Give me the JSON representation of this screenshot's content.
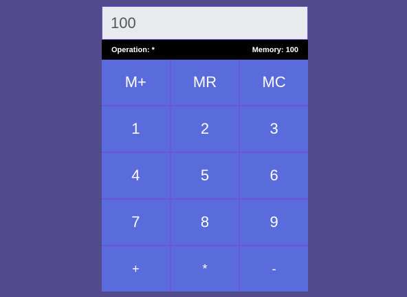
{
  "display": {
    "value": "100"
  },
  "status": {
    "operation": "Operation: *",
    "memory": "Memory: 100"
  },
  "buttons": [
    {
      "label": "M+",
      "name": "memory-add-button"
    },
    {
      "label": "MR",
      "name": "memory-recall-button"
    },
    {
      "label": "MC",
      "name": "memory-clear-button"
    },
    {
      "label": "1",
      "name": "digit-1-button"
    },
    {
      "label": "2",
      "name": "digit-2-button"
    },
    {
      "label": "3",
      "name": "digit-3-button"
    },
    {
      "label": "4",
      "name": "digit-4-button"
    },
    {
      "label": "5",
      "name": "digit-5-button"
    },
    {
      "label": "6",
      "name": "digit-6-button"
    },
    {
      "label": "7",
      "name": "digit-7-button"
    },
    {
      "label": "8",
      "name": "digit-8-button"
    },
    {
      "label": "9",
      "name": "digit-9-button"
    },
    {
      "label": "+",
      "name": "add-button"
    },
    {
      "label": "*",
      "name": "multiply-button"
    },
    {
      "label": "-",
      "name": "subtract-button"
    }
  ],
  "colors": {
    "background": "#534a8b",
    "button": "#5a6bdb",
    "divider": "#6a55dd",
    "status_bar": "#000000"
  }
}
